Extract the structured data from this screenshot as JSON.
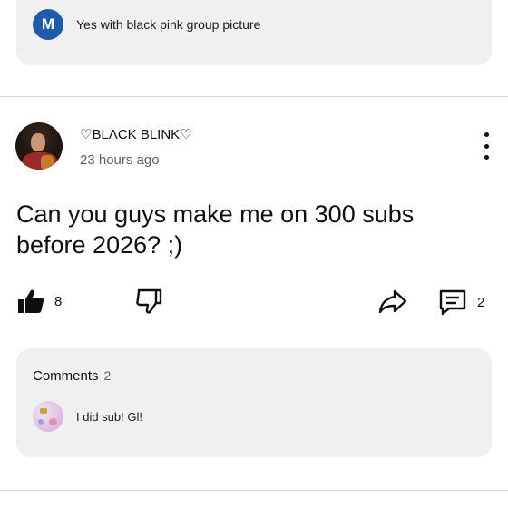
{
  "top_reply": {
    "avatar_letter": "M",
    "text": "Yes with  black pink  group picture"
  },
  "post": {
    "channel_name": "♡BLΛCK BLINK♡",
    "timestamp": "23 hours ago",
    "text_line1": "Can you guys make me on 300 subs",
    "text_line2": "before 2026? ;)"
  },
  "actions": {
    "like_count": "8",
    "comment_count": "2"
  },
  "comments": {
    "title": "Comments",
    "count": "2",
    "first_comment": "I did sub! Gl!"
  },
  "colors": {
    "avatar_m_bg": "#1e5cab",
    "card_bg": "#f0f0f0",
    "secondary_text": "#606060"
  }
}
